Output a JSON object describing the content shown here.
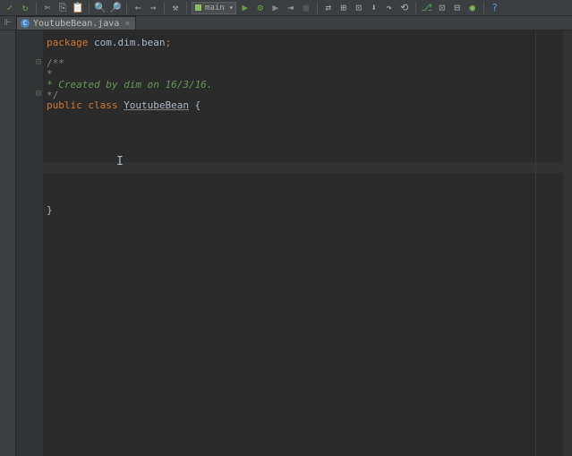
{
  "toolbar": {
    "run_config": "main"
  },
  "tabs": {
    "active": {
      "filename": "YoutubeBean.java",
      "icon_letter": "C"
    }
  },
  "code": {
    "line1_kw": "package",
    "line1_pkg": " com.dim.bean",
    "line1_semi": ";",
    "doc_open": "/**",
    "doc_mid": " *",
    "doc_created": " * Created by dim on 16/3/16.",
    "doc_close": " */",
    "class_public": "public ",
    "class_kw": "class ",
    "class_name": "YoutubeBean",
    "class_brace": " {",
    "close_brace": "}"
  }
}
